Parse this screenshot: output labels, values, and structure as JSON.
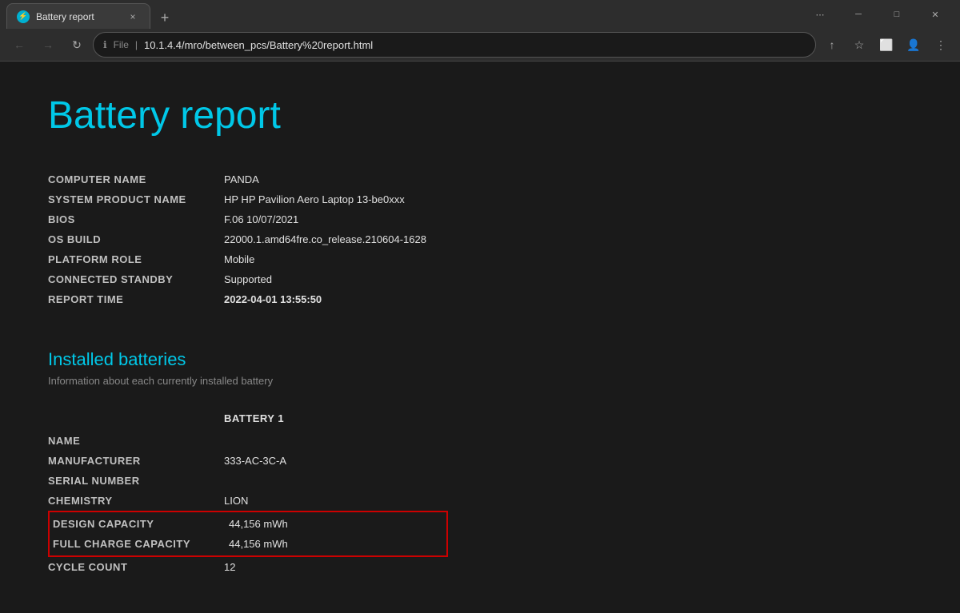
{
  "browser": {
    "tab": {
      "favicon_symbol": "⚡",
      "title": "Battery report",
      "close_label": "×"
    },
    "new_tab_label": "+",
    "window_controls": {
      "minimize": "─",
      "maximize": "□",
      "close": "✕",
      "more_options": "⋯"
    },
    "nav": {
      "back_label": "←",
      "forward_label": "→",
      "reload_label": "↻",
      "address_file_label": "File",
      "address_separator": "|",
      "address_url": "10.1.4.4/mro/between_pcs/Battery%20report.html",
      "share_icon": "↑",
      "bookmark_icon": "☆",
      "split_icon": "⬜",
      "profile_icon": "👤",
      "more_icon": "⋮"
    }
  },
  "page": {
    "title": "Battery report",
    "system_info": {
      "rows": [
        {
          "label": "COMPUTER NAME",
          "value": "PANDA",
          "bold": false
        },
        {
          "label": "SYSTEM PRODUCT NAME",
          "value": "HP HP Pavilion Aero Laptop 13-be0xxx",
          "bold": false
        },
        {
          "label": "BIOS",
          "value": "F.06 10/07/2021",
          "bold": false
        },
        {
          "label": "OS BUILD",
          "value": "22000.1.amd64fre.co_release.210604-1628",
          "bold": false
        },
        {
          "label": "PLATFORM ROLE",
          "value": "Mobile",
          "bold": false
        },
        {
          "label": "CONNECTED STANDBY",
          "value": "Supported",
          "bold": false
        },
        {
          "label": "REPORT TIME",
          "value": "2022-04-01  13:55:50",
          "bold": true
        }
      ]
    },
    "installed_batteries": {
      "section_title": "Installed batteries",
      "section_subtitle": "Information about each currently installed battery",
      "battery_header": "BATTERY 1",
      "rows": [
        {
          "label": "NAME",
          "value": "",
          "highlighted": false
        },
        {
          "label": "MANUFACTURER",
          "value": "333-AC-3C-A",
          "highlighted": false
        },
        {
          "label": "SERIAL NUMBER",
          "value": "",
          "highlighted": false
        },
        {
          "label": "CHEMISTRY",
          "value": "LION",
          "highlighted": false
        },
        {
          "label": "DESIGN CAPACITY",
          "value": "44,156 mWh",
          "highlighted": true
        },
        {
          "label": "FULL CHARGE CAPACITY",
          "value": "44,156 mWh",
          "highlighted": true
        },
        {
          "label": "CYCLE COUNT",
          "value": "12",
          "highlighted": false
        }
      ]
    }
  }
}
